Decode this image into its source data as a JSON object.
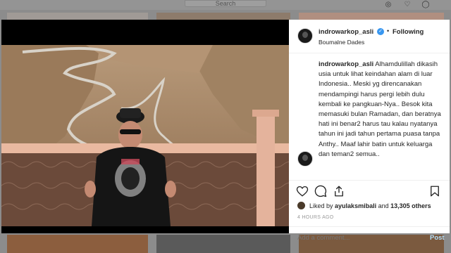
{
  "search": {
    "placeholder": "Search"
  },
  "post": {
    "username": "indrowarkop_asli",
    "follow_status": "Following",
    "dot": "•",
    "location": "Boumalne Dades",
    "caption_username": "indrowarkop_asli",
    "caption_text": "Alhamdulillah dikasih usia untuk lihat keindahan alam di luar Indonesia.. Meski yg direncanakan mendampingi harus pergi lebih dulu kembali ke pangkuan-Nya.. Besok kita memasuki bulan Ramadan, dan beratnya hati ini benar2 harus tau kalau nyatanya tahun ini jadi tahun pertama puasa tanpa Anthy.. Maaf lahir batin untuk keluarga dan teman2 semua..",
    "liked_prefix": "Liked by",
    "liked_user": "ayulaksmibali",
    "liked_and": "and",
    "liked_count": "13,305 others",
    "timestamp": "4 HOURS AGO",
    "comment_placeholder": "Add a comment...",
    "post_label": "Post"
  },
  "colors": {
    "verified": "#3897f0",
    "post_disabled": "#b2dffc"
  }
}
